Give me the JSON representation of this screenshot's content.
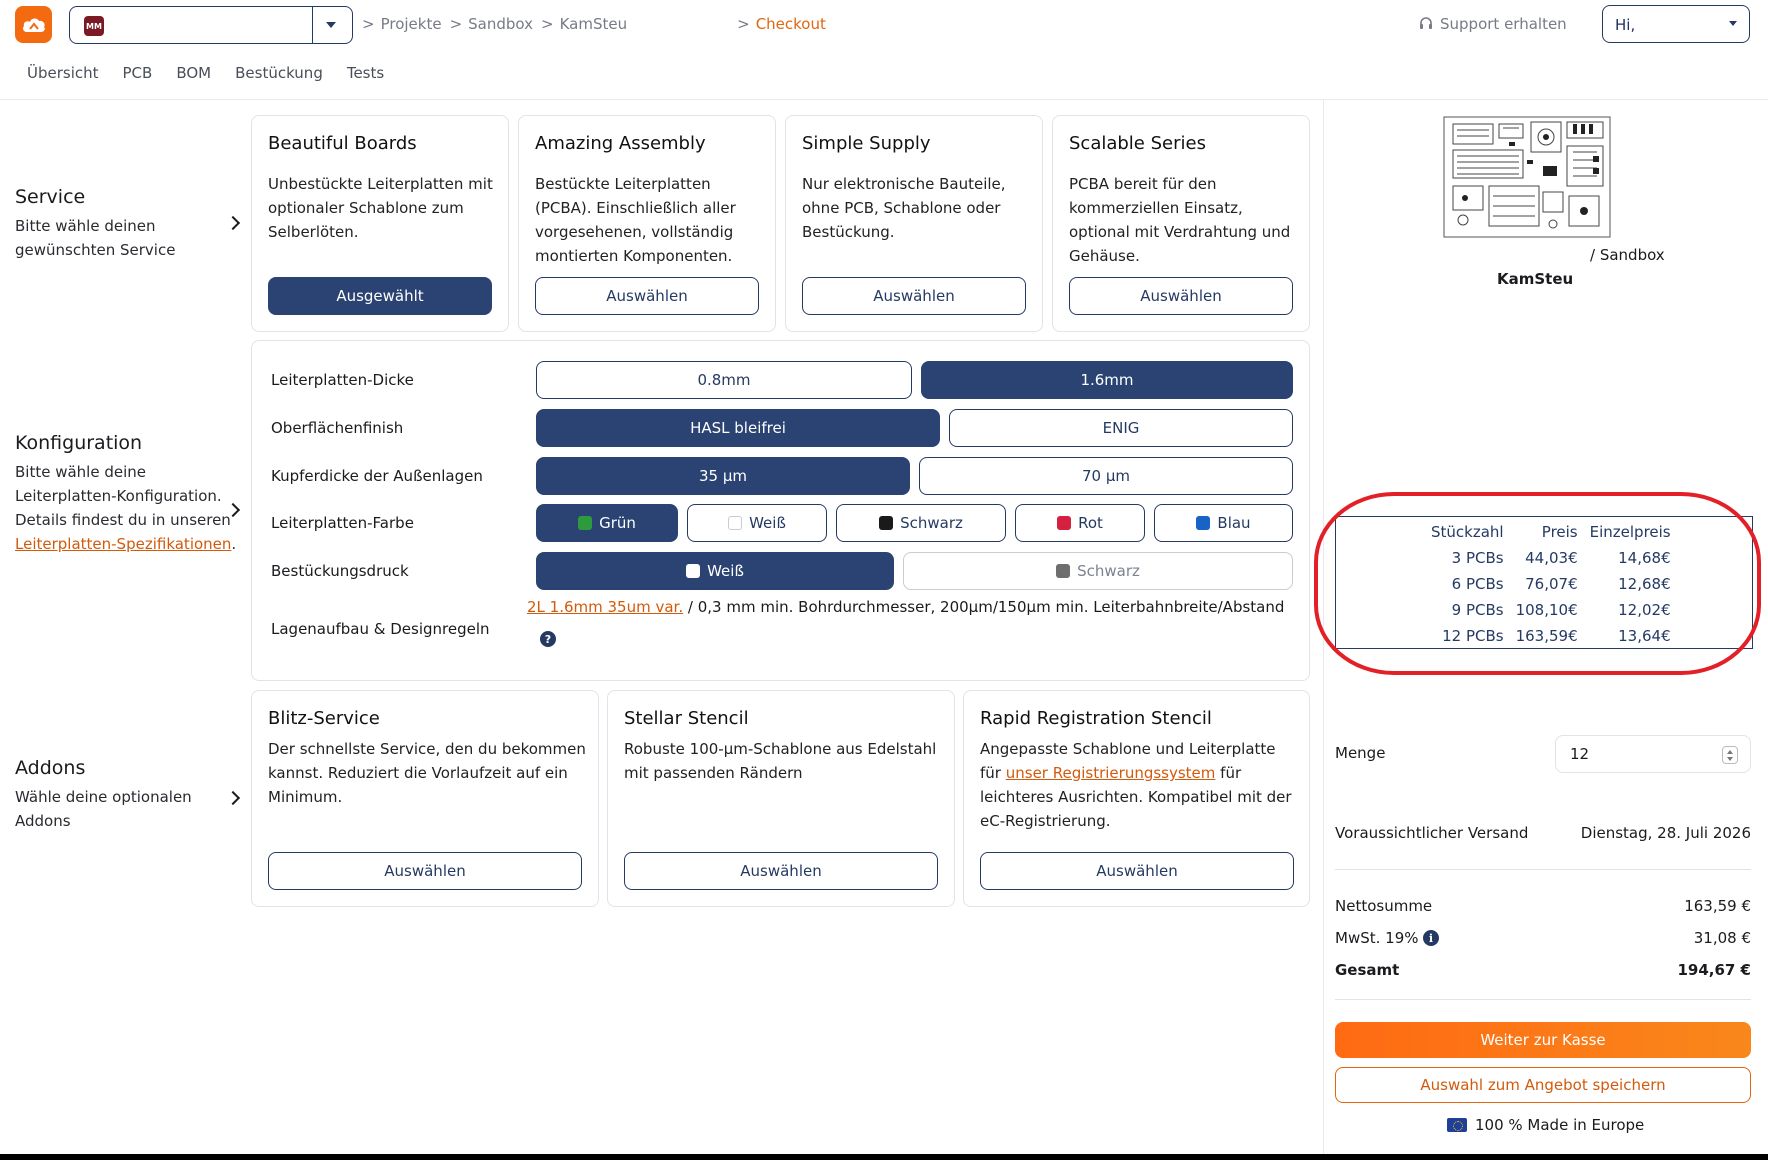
{
  "header": {
    "project_avatar": "MM",
    "breadcrumbs": [
      "Projekte",
      "Sandbox",
      "KamSteu"
    ],
    "breadcrumb_active": "Checkout",
    "support_label": "Support erhalten",
    "user_greeting": "Hi,"
  },
  "subnav": [
    "Übersicht",
    "PCB",
    "BOM",
    "Bestückung",
    "Tests"
  ],
  "service": {
    "title": "Service",
    "desc": "Bitte wähle deinen gewünschten Service",
    "cards": [
      {
        "title": "Beautiful Boards",
        "desc": "Unbestückte Leiterplatten mit optionaler Schablone zum Selberlöten.",
        "button": "Ausgewählt"
      },
      {
        "title": "Amazing Assembly",
        "desc": "Bestückte Leiterplatten (PCBA). Einschließlich aller vorgesehenen, vollständig montierten Komponenten.",
        "button": "Auswählen"
      },
      {
        "title": "Simple Supply",
        "desc": "Nur elektronische Bauteile, ohne PCB, Schablone oder Bestückung.",
        "button": "Auswählen"
      },
      {
        "title": "Scalable Series",
        "desc": "PCBA bereit für den kommerziellen Einsatz, optional mit Verdrahtung und Gehäuse.",
        "button": "Auswählen"
      }
    ]
  },
  "config": {
    "title": "Konfiguration",
    "desc": "Bitte wähle deine Leiterplatten-Konfiguration. Details findest du in unseren",
    "desc_link": "Leiterplatten-Spezifikationen",
    "desc_end": ".",
    "thickness": {
      "label": "Leiterplatten-Dicke",
      "options": [
        "0.8mm",
        "1.6mm"
      ],
      "selected": "1.6mm"
    },
    "finish": {
      "label": "Oberflächenfinish",
      "options": [
        "HASL bleifrei",
        "ENIG"
      ],
      "selected": "HASL bleifrei"
    },
    "copper": {
      "label": "Kupferdicke der Außenlagen",
      "options": [
        "35 µm",
        "70 µm"
      ],
      "selected": "35 µm"
    },
    "color": {
      "label": "Leiterplatten-Farbe",
      "options": [
        {
          "label": "Grün",
          "swatch": "#2e9a3e"
        },
        {
          "label": "Weiß",
          "swatch": "#ffffff"
        },
        {
          "label": "Schwarz",
          "swatch": "#1a1a1a"
        },
        {
          "label": "Rot",
          "swatch": "#d5203f"
        },
        {
          "label": "Blau",
          "swatch": "#1a63c6"
        }
      ],
      "selected": "Grün"
    },
    "silkscreen": {
      "label": "Bestückungsdruck",
      "options": [
        {
          "label": "Weiß",
          "swatch": "#ffffff"
        },
        {
          "label": "Schwarz",
          "swatch": "#6e6e6e"
        }
      ],
      "selected": "Weiß"
    },
    "stackup": {
      "label": "Lagenaufbau & Designregeln",
      "link": "2L 1.6mm 35um var.",
      "text": " / 0,3 mm min. Bohrdurchmesser, 200µm/150µm min. Leiterbahnbreite/Abstand",
      "help": "?"
    }
  },
  "addons": {
    "title": "Addons",
    "desc": "Wähle deine optionalen Addons",
    "cards": [
      {
        "title": "Blitz-Service",
        "desc": "Der schnellste Service, den du bekommen kannst. Reduziert die Vorlaufzeit auf ein Minimum.",
        "button": "Auswählen"
      },
      {
        "title": "Stellar Stencil",
        "desc": "Robuste 100-µm-Schablone aus Edelstahl mit passenden Rändern",
        "button": "Auswählen"
      },
      {
        "title": "Rapid Registration Stencil",
        "desc_pre": "Angepasste Schablone und Leiterplatte für ",
        "desc_link": "unser Registrierungssystem",
        "desc_post": " für leichteres Ausrichten. Kompatibel mit der eC-Registrierung.",
        "button": "Auswählen"
      }
    ]
  },
  "summary": {
    "project_path": "/ Sandbox",
    "project_name": "KamSteu",
    "price_table": {
      "headers": [
        "Stückzahl",
        "Preis",
        "Einzelpreis"
      ],
      "rows": [
        [
          "3 PCBs",
          "44,03€",
          "14,68€"
        ],
        [
          "6 PCBs",
          "76,07€",
          "12,68€"
        ],
        [
          "9 PCBs",
          "108,10€",
          "12,02€"
        ],
        [
          "12 PCBs",
          "163,59€",
          "13,64€"
        ]
      ]
    },
    "quantity_label": "Menge",
    "quantity_value": "12",
    "shipping_label": "Voraussichtlicher Versand",
    "shipping_value": "Dienstag, 28. Juli 2026",
    "net_label": "Nettosumme",
    "net_value": "163,59 €",
    "vat_label": "MwSt. 19%",
    "vat_value": "31,08 €",
    "total_label": "Gesamt",
    "total_value": "194,67 €",
    "checkout_button": "Weiter zur Kasse",
    "save_button": "Auswahl zum Angebot speichern",
    "made_in": "100 % Made in Europe"
  },
  "colors": {
    "primary": "#2a4372",
    "accent": "#f36a10",
    "highlight": "#e32027"
  }
}
